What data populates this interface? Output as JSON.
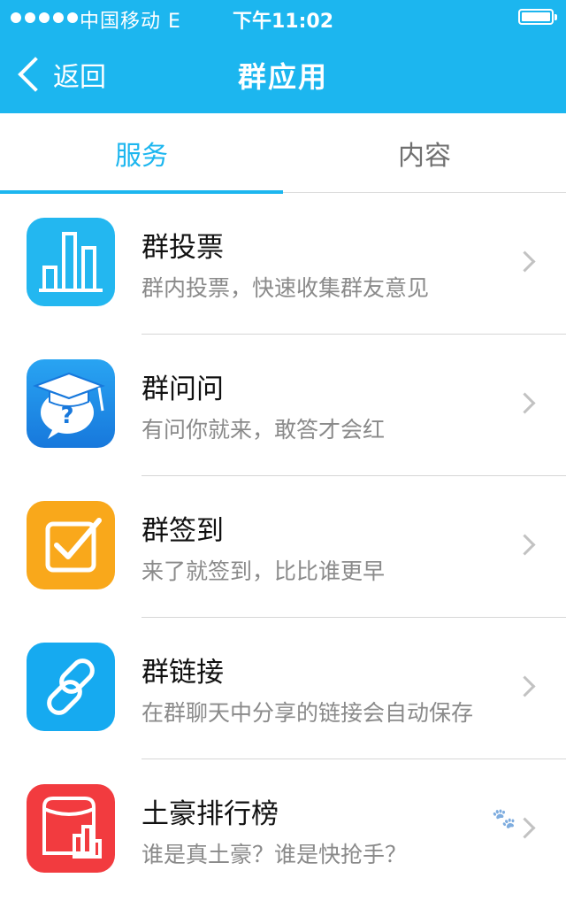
{
  "status_bar": {
    "carrier": "中国移动  E",
    "time": "下午11:02"
  },
  "nav": {
    "back_label": "返回",
    "title": "群应用"
  },
  "tabs": [
    {
      "label": "服务",
      "active": true
    },
    {
      "label": "内容",
      "active": false
    }
  ],
  "apps": [
    {
      "title": "群投票",
      "subtitle": "群内投票，快速收集群友意见",
      "icon": "bar-chart-icon",
      "color": "#23b7f0"
    },
    {
      "title": "群问问",
      "subtitle": "有问你就来，敢答才会红",
      "icon": "graduation-cap-question-icon",
      "color": "#1a8fe3"
    },
    {
      "title": "群签到",
      "subtitle": "来了就签到，比比谁更早",
      "icon": "checkbox-icon",
      "color": "#f9a81b"
    },
    {
      "title": "群链接",
      "subtitle": "在群聊天中分享的链接会自动保存",
      "icon": "link-icon",
      "color": "#16aaf0"
    },
    {
      "title": "土豪排行榜",
      "subtitle": "谁是真土豪？谁是快抢手？",
      "icon": "ranking-icon",
      "color": "#f23b3f"
    }
  ],
  "colors": {
    "accent": "#1cb6ef"
  }
}
